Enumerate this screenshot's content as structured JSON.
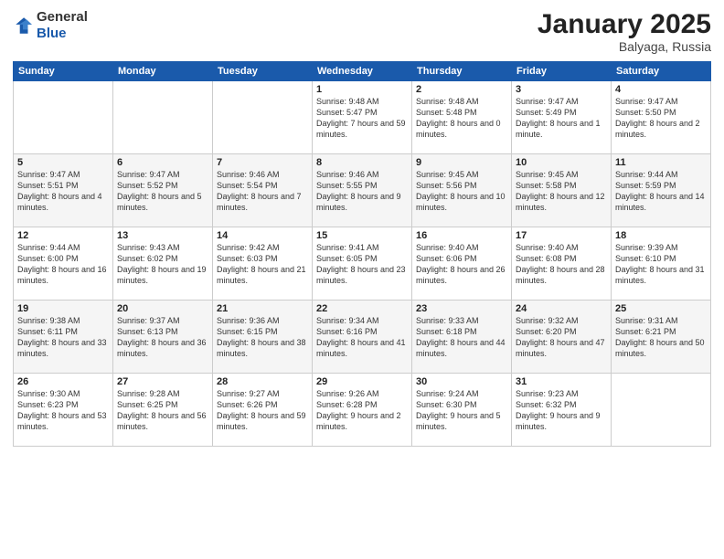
{
  "header": {
    "logo_general": "General",
    "logo_blue": "Blue",
    "title": "January 2025",
    "location": "Balyaga, Russia"
  },
  "weekdays": [
    "Sunday",
    "Monday",
    "Tuesday",
    "Wednesday",
    "Thursday",
    "Friday",
    "Saturday"
  ],
  "weeks": [
    [
      {
        "day": "",
        "info": ""
      },
      {
        "day": "",
        "info": ""
      },
      {
        "day": "",
        "info": ""
      },
      {
        "day": "1",
        "info": "Sunrise: 9:48 AM\nSunset: 5:47 PM\nDaylight: 7 hours and 59 minutes."
      },
      {
        "day": "2",
        "info": "Sunrise: 9:48 AM\nSunset: 5:48 PM\nDaylight: 8 hours and 0 minutes."
      },
      {
        "day": "3",
        "info": "Sunrise: 9:47 AM\nSunset: 5:49 PM\nDaylight: 8 hours and 1 minute."
      },
      {
        "day": "4",
        "info": "Sunrise: 9:47 AM\nSunset: 5:50 PM\nDaylight: 8 hours and 2 minutes."
      }
    ],
    [
      {
        "day": "5",
        "info": "Sunrise: 9:47 AM\nSunset: 5:51 PM\nDaylight: 8 hours and 4 minutes."
      },
      {
        "day": "6",
        "info": "Sunrise: 9:47 AM\nSunset: 5:52 PM\nDaylight: 8 hours and 5 minutes."
      },
      {
        "day": "7",
        "info": "Sunrise: 9:46 AM\nSunset: 5:54 PM\nDaylight: 8 hours and 7 minutes."
      },
      {
        "day": "8",
        "info": "Sunrise: 9:46 AM\nSunset: 5:55 PM\nDaylight: 8 hours and 9 minutes."
      },
      {
        "day": "9",
        "info": "Sunrise: 9:45 AM\nSunset: 5:56 PM\nDaylight: 8 hours and 10 minutes."
      },
      {
        "day": "10",
        "info": "Sunrise: 9:45 AM\nSunset: 5:58 PM\nDaylight: 8 hours and 12 minutes."
      },
      {
        "day": "11",
        "info": "Sunrise: 9:44 AM\nSunset: 5:59 PM\nDaylight: 8 hours and 14 minutes."
      }
    ],
    [
      {
        "day": "12",
        "info": "Sunrise: 9:44 AM\nSunset: 6:00 PM\nDaylight: 8 hours and 16 minutes."
      },
      {
        "day": "13",
        "info": "Sunrise: 9:43 AM\nSunset: 6:02 PM\nDaylight: 8 hours and 19 minutes."
      },
      {
        "day": "14",
        "info": "Sunrise: 9:42 AM\nSunset: 6:03 PM\nDaylight: 8 hours and 21 minutes."
      },
      {
        "day": "15",
        "info": "Sunrise: 9:41 AM\nSunset: 6:05 PM\nDaylight: 8 hours and 23 minutes."
      },
      {
        "day": "16",
        "info": "Sunrise: 9:40 AM\nSunset: 6:06 PM\nDaylight: 8 hours and 26 minutes."
      },
      {
        "day": "17",
        "info": "Sunrise: 9:40 AM\nSunset: 6:08 PM\nDaylight: 8 hours and 28 minutes."
      },
      {
        "day": "18",
        "info": "Sunrise: 9:39 AM\nSunset: 6:10 PM\nDaylight: 8 hours and 31 minutes."
      }
    ],
    [
      {
        "day": "19",
        "info": "Sunrise: 9:38 AM\nSunset: 6:11 PM\nDaylight: 8 hours and 33 minutes."
      },
      {
        "day": "20",
        "info": "Sunrise: 9:37 AM\nSunset: 6:13 PM\nDaylight: 8 hours and 36 minutes."
      },
      {
        "day": "21",
        "info": "Sunrise: 9:36 AM\nSunset: 6:15 PM\nDaylight: 8 hours and 38 minutes."
      },
      {
        "day": "22",
        "info": "Sunrise: 9:34 AM\nSunset: 6:16 PM\nDaylight: 8 hours and 41 minutes."
      },
      {
        "day": "23",
        "info": "Sunrise: 9:33 AM\nSunset: 6:18 PM\nDaylight: 8 hours and 44 minutes."
      },
      {
        "day": "24",
        "info": "Sunrise: 9:32 AM\nSunset: 6:20 PM\nDaylight: 8 hours and 47 minutes."
      },
      {
        "day": "25",
        "info": "Sunrise: 9:31 AM\nSunset: 6:21 PM\nDaylight: 8 hours and 50 minutes."
      }
    ],
    [
      {
        "day": "26",
        "info": "Sunrise: 9:30 AM\nSunset: 6:23 PM\nDaylight: 8 hours and 53 minutes."
      },
      {
        "day": "27",
        "info": "Sunrise: 9:28 AM\nSunset: 6:25 PM\nDaylight: 8 hours and 56 minutes."
      },
      {
        "day": "28",
        "info": "Sunrise: 9:27 AM\nSunset: 6:26 PM\nDaylight: 8 hours and 59 minutes."
      },
      {
        "day": "29",
        "info": "Sunrise: 9:26 AM\nSunset: 6:28 PM\nDaylight: 9 hours and 2 minutes."
      },
      {
        "day": "30",
        "info": "Sunrise: 9:24 AM\nSunset: 6:30 PM\nDaylight: 9 hours and 5 minutes."
      },
      {
        "day": "31",
        "info": "Sunrise: 9:23 AM\nSunset: 6:32 PM\nDaylight: 9 hours and 9 minutes."
      },
      {
        "day": "",
        "info": ""
      }
    ]
  ]
}
